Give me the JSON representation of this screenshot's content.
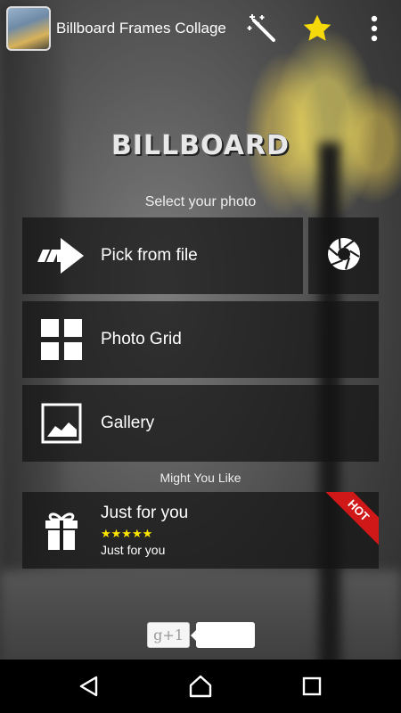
{
  "app": {
    "title": "Billboard Frames Collage",
    "logo_text": "BILLBOARD"
  },
  "toolbar": {
    "icons": [
      "magic-wand-icon",
      "star-icon",
      "more-vert-icon"
    ],
    "star_color": "#f5d90a"
  },
  "main": {
    "select_label": "Select your photo",
    "pick_file_label": "Pick from file",
    "photo_grid_label": "Photo Grid",
    "gallery_label": "Gallery",
    "might_like_label": "Might You Like"
  },
  "promo": {
    "title": "Just for you",
    "stars": "★★★★★",
    "subtitle": "Just for you",
    "badge": "HOT",
    "badge_color": "#d01818"
  },
  "gplus": {
    "label": "g+1"
  },
  "navigation": {
    "icons": [
      "back-icon",
      "home-icon",
      "recents-icon"
    ]
  }
}
